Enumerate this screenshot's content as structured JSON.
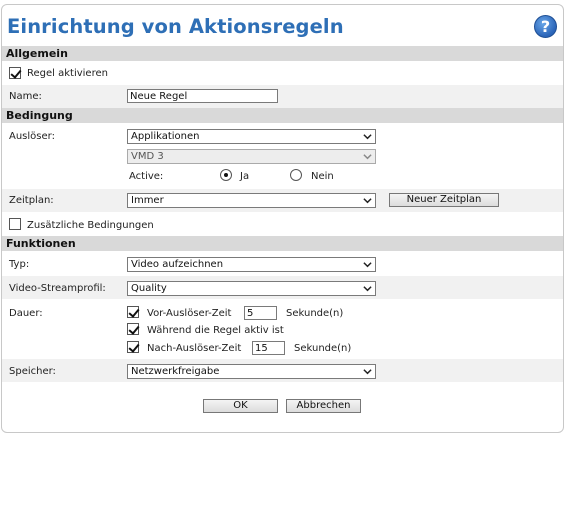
{
  "title": "Einrichtung von Aktionsregeln",
  "help_glyph": "?",
  "allgemein": {
    "header": "Allgemein",
    "activate_label": "Regel aktivieren",
    "activate_checked": true,
    "name_label": "Name:",
    "name_value": "Neue Regel"
  },
  "bedingung": {
    "header": "Bedingung",
    "trigger_label": "Auslöser:",
    "trigger_value": "Applikationen",
    "trigger_sub_value": "VMD 3",
    "active_label": "Active:",
    "active_yes": "Ja",
    "active_no": "Nein",
    "active_selected": "Ja",
    "schedule_label": "Zeitplan:",
    "schedule_value": "Immer",
    "new_schedule_button": "Neuer Zeitplan",
    "extra_conditions_label": "Zusätzliche Bedingungen",
    "extra_conditions_checked": false
  },
  "funktionen": {
    "header": "Funktionen",
    "type_label": "Typ:",
    "type_value": "Video aufzeichnen",
    "stream_label": "Video-Streamprofil:",
    "stream_value": "Quality",
    "duration_label": "Dauer:",
    "pre_trigger_label": "Vor-Auslöser-Zeit",
    "pre_trigger_value": "5",
    "pre_trigger_unit": "Sekunde(n)",
    "pre_trigger_checked": true,
    "while_active_label": "Während die Regel aktiv ist",
    "while_active_checked": true,
    "post_trigger_label": "Nach-Auslöser-Zeit",
    "post_trigger_value": "15",
    "post_trigger_unit": "Sekunde(n)",
    "post_trigger_checked": true,
    "storage_label": "Speicher:",
    "storage_value": "Netzwerkfreigabe"
  },
  "buttons": {
    "ok": "OK",
    "cancel": "Abbrechen"
  },
  "colors": {
    "title": "#2e6fb6",
    "section_header": "#d9d9d9",
    "row_shade": "#f1f1f1"
  }
}
